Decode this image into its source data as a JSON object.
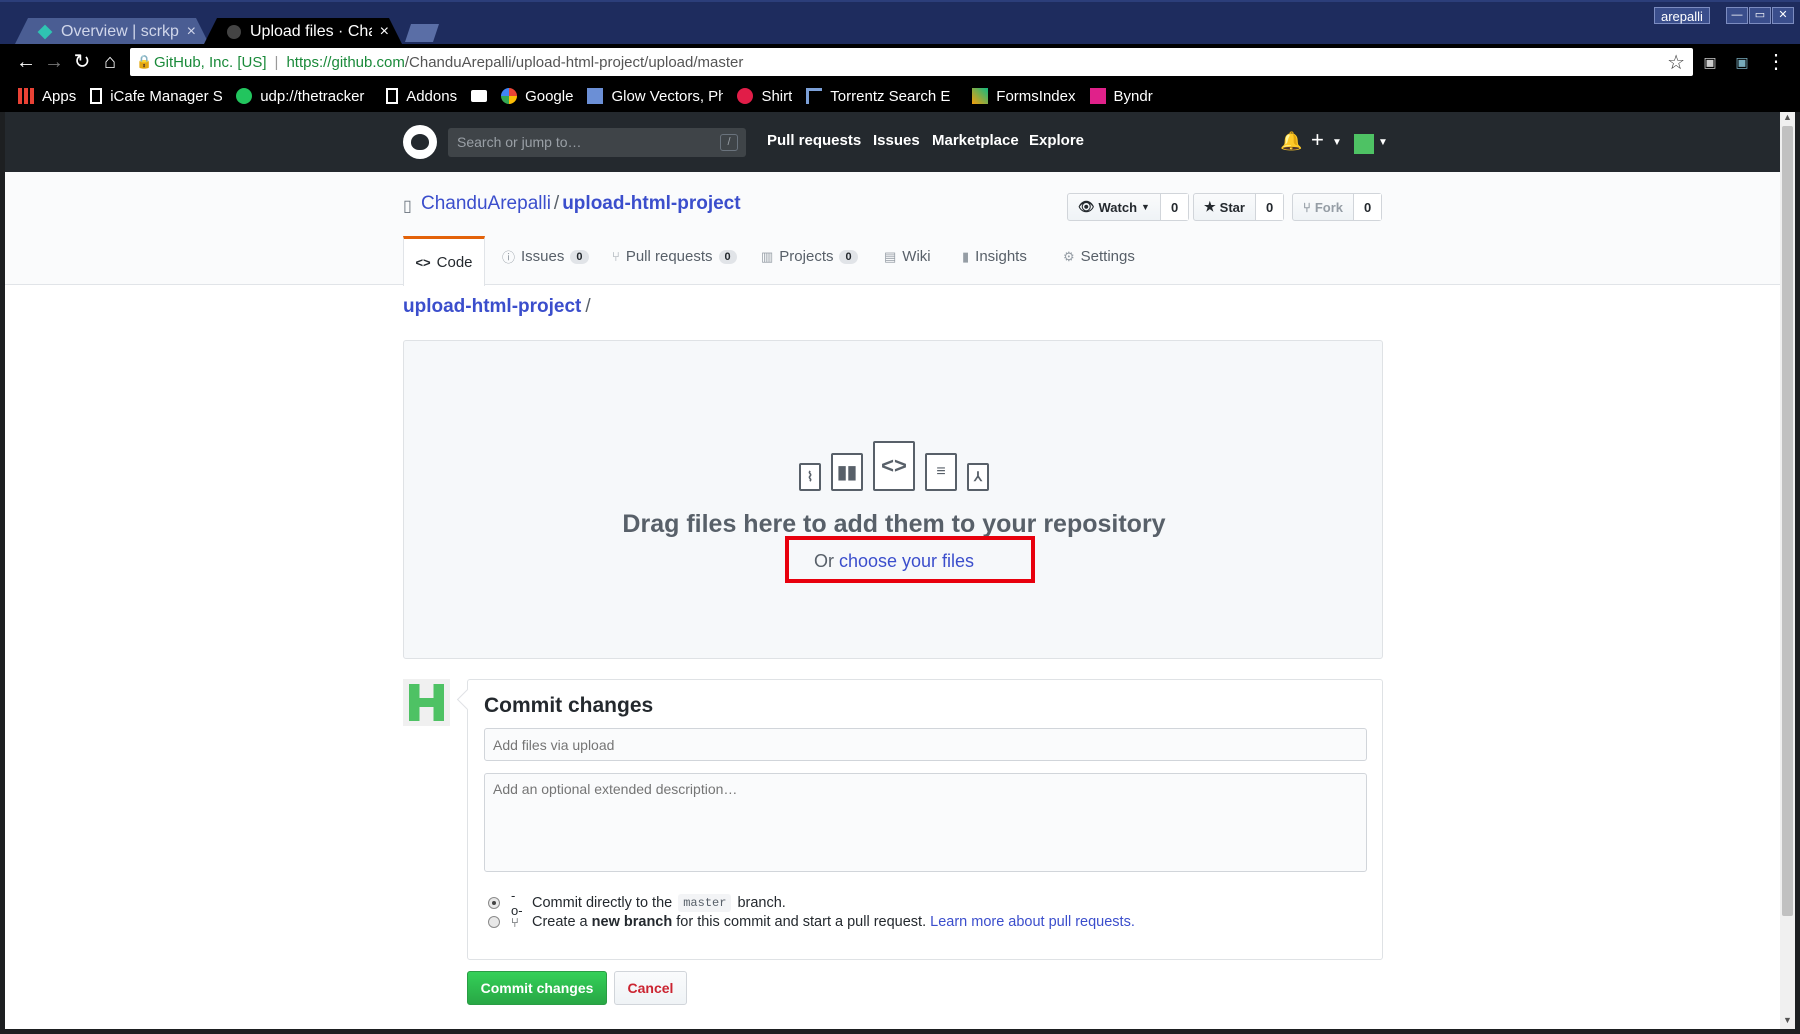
{
  "browser": {
    "tabs": [
      {
        "title": "Overview | scrkpro",
        "close": "×"
      },
      {
        "title": "Upload files · Chand",
        "close": "×"
      }
    ],
    "window_user": "arepalli",
    "address": {
      "site_identity": "GitHub, Inc. [US]",
      "url_host": "https://github.com",
      "url_path": "/ChanduArepalli/upload-html-project/upload/master"
    },
    "bookmarks": [
      {
        "label": "Apps",
        "icon": "apps-grid-icon",
        "color": "#e94235"
      },
      {
        "label": "iCafe Manager Se",
        "icon": "page-icon",
        "color": "#ffffff"
      },
      {
        "label": "udp://thetracker",
        "icon": "star-badge-icon",
        "color": "#22c55e"
      },
      {
        "label": "Addons",
        "icon": "page-icon",
        "color": "#ffffff"
      },
      {
        "label": "",
        "icon": "folder-icon",
        "color": "#ffffff"
      },
      {
        "label": "Google",
        "icon": "google-icon",
        "color": "#ea4335"
      },
      {
        "label": "Glow Vectors, Ph",
        "icon": "image-icon",
        "color": "#6b8fd6"
      },
      {
        "label": "Shirt",
        "icon": "shirt-icon",
        "color": "#e11d48"
      },
      {
        "label": "Torrentz Search E",
        "icon": "torrentz-icon",
        "color": "#7ca0d8"
      },
      {
        "label": "FormsIndex",
        "icon": "forms-icon",
        "color": "#f59e0b"
      },
      {
        "label": "Byndr",
        "icon": "byndr-icon",
        "color": "#e0218a"
      }
    ]
  },
  "github_header": {
    "search_placeholder": "Search or jump to…",
    "search_shortcut": "/",
    "nav": [
      "Pull requests",
      "Issues",
      "Marketplace",
      "Explore"
    ]
  },
  "repo": {
    "owner": "ChanduArepalli",
    "separator": "/",
    "name": "upload-html-project",
    "actions": {
      "watch": {
        "label": "Watch",
        "count": "0"
      },
      "star": {
        "label": "Star",
        "count": "0"
      },
      "fork": {
        "label": "Fork",
        "count": "0"
      }
    },
    "tabs": [
      {
        "label": "Code",
        "icon": "<>",
        "count": null
      },
      {
        "label": "Issues",
        "icon": "ⓘ",
        "count": "0"
      },
      {
        "label": "Pull requests",
        "icon": "⑂",
        "count": "0"
      },
      {
        "label": "Projects",
        "icon": "▥",
        "count": "0"
      },
      {
        "label": "Wiki",
        "icon": "▤",
        "count": null
      },
      {
        "label": "Insights",
        "icon": "▮",
        "count": null
      },
      {
        "label": "Settings",
        "icon": "⚙",
        "count": null
      }
    ]
  },
  "breadcrumb": {
    "repo": "upload-html-project",
    "sep": "/"
  },
  "dropzone": {
    "title": "Drag files here to add them to your repository",
    "or_text": "Or ",
    "choose_link": "choose your files",
    "highlight_color": "#e8000d"
  },
  "commit": {
    "title": "Commit changes",
    "summary_placeholder": "Add files via upload",
    "description_placeholder": "Add an optional extended description…",
    "option_direct": {
      "prefix": "Commit directly to the",
      "branch": "master",
      "suffix": "branch."
    },
    "option_new": {
      "prefix": "Create a",
      "bold": "new branch",
      "suffix": "for this commit and start a pull request.",
      "link": "Learn more about pull requests."
    },
    "submit_label": "Commit changes",
    "cancel_label": "Cancel"
  }
}
